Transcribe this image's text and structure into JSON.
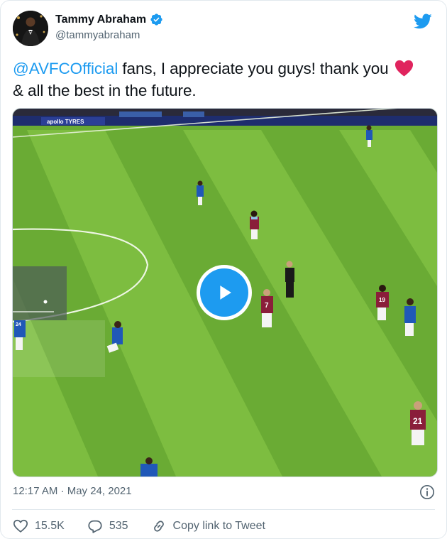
{
  "author": {
    "display_name": "Tammy Abraham",
    "handle": "@tammyabraham",
    "verified": true
  },
  "tweet": {
    "mention": "@AVFCOfficial",
    "text_after_mention": " fans, I appreciate you guys! thank you",
    "emoji": "heart-emoji",
    "text_line2": "& all the best in the future."
  },
  "media": {
    "type": "video",
    "board_text": "apollo TYRES",
    "shirt_numbers": [
      "7",
      "19",
      "21",
      "24"
    ]
  },
  "meta": {
    "timestamp": "12:17 AM · May 24, 2021"
  },
  "actions": {
    "likes": "15.5K",
    "replies": "535",
    "copy_link_label": "Copy link to Tweet"
  },
  "colors": {
    "accent": "#1d9bf0",
    "heart": "#e0245e",
    "pitch_light": "#7fbb3c",
    "pitch_dark": "#5fa02c"
  }
}
